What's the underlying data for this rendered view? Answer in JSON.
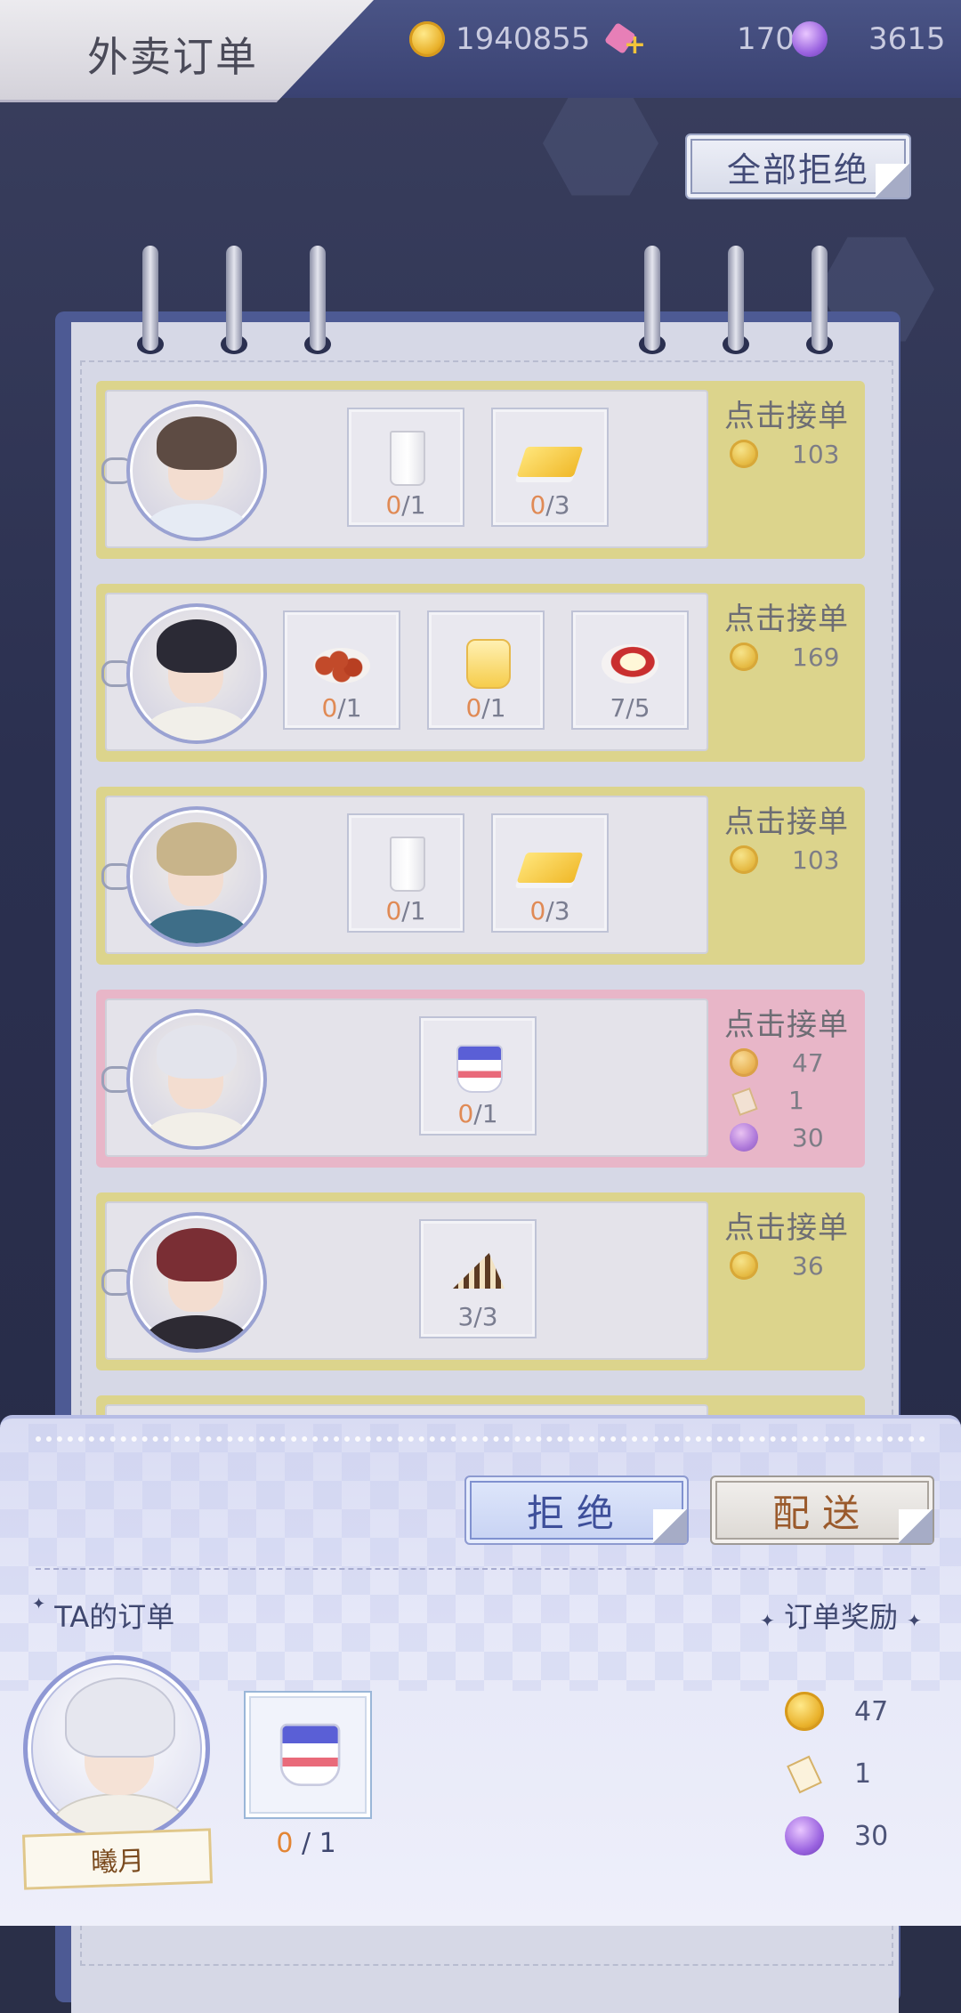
{
  "header": {
    "title": "外卖订单",
    "coins": "1940855",
    "tickets": "170",
    "gems": "3615"
  },
  "reject_all_label": "全部拒绝",
  "orders": [
    {
      "style": "yellow",
      "items": [
        {
          "icon": "milk-glass",
          "have": "0",
          "need": "1"
        },
        {
          "icon": "butter",
          "have": "0",
          "need": "3"
        }
      ],
      "accept_label": "点击接单",
      "rewards": [
        {
          "icon": "coin-icon",
          "value": "103"
        }
      ]
    },
    {
      "style": "yellow",
      "items": [
        {
          "icon": "berries-plate",
          "have": "0",
          "need": "1"
        },
        {
          "icon": "honey-jar",
          "have": "0",
          "need": "1"
        },
        {
          "icon": "pudding-plate",
          "have": "7",
          "need": "5"
        }
      ],
      "accept_label": "点击接单",
      "rewards": [
        {
          "icon": "coin-icon",
          "value": "169"
        }
      ]
    },
    {
      "style": "yellow",
      "items": [
        {
          "icon": "milk-glass",
          "have": "0",
          "need": "1"
        },
        {
          "icon": "butter",
          "have": "0",
          "need": "3"
        }
      ],
      "accept_label": "点击接单",
      "rewards": [
        {
          "icon": "coin-icon",
          "value": "103"
        }
      ]
    },
    {
      "style": "pink",
      "items": [
        {
          "icon": "blueberry-cup",
          "have": "0",
          "need": "1"
        }
      ],
      "accept_label": "点击接单",
      "rewards": [
        {
          "icon": "coin-icon",
          "value": "47"
        },
        {
          "icon": "card-icon",
          "value": "1"
        },
        {
          "icon": "gem-icon",
          "value": "30"
        }
      ]
    },
    {
      "style": "yellow",
      "items": [
        {
          "icon": "cake-slice",
          "have": "3",
          "need": "3"
        }
      ],
      "accept_label": "点击接单",
      "rewards": [
        {
          "icon": "coin-icon",
          "value": "36"
        }
      ]
    },
    {
      "style": "yellow",
      "items": [],
      "accept_label": "点击接单",
      "rewards": []
    }
  ],
  "panel": {
    "reject_label": "拒绝",
    "deliver_label": "配送",
    "my_order_title": "TA的订单",
    "reward_title": "订单奖励",
    "customer_name": "曦月",
    "item": {
      "icon": "blueberry-cup",
      "have": "0",
      "need": "1"
    },
    "rewards": [
      {
        "icon": "coin-icon",
        "value": "47"
      },
      {
        "icon": "card-icon",
        "value": "1"
      },
      {
        "icon": "gem-icon",
        "value": "30"
      }
    ]
  }
}
